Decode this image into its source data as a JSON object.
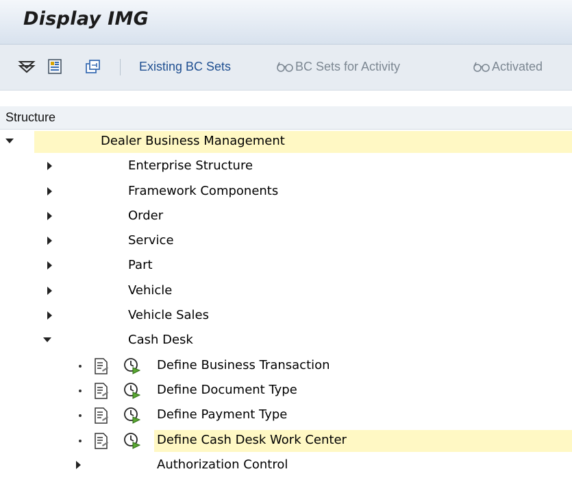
{
  "window": {
    "title": "Display IMG"
  },
  "toolbar": {
    "buttons": [
      {
        "label": "Existing BC Sets"
      },
      {
        "label": "BC Sets for Activity"
      },
      {
        "label": "Activated"
      }
    ]
  },
  "structure": {
    "header": "Structure"
  },
  "tree": {
    "root": {
      "label": "Dealer Business Management",
      "expanded": true
    },
    "items": [
      {
        "label": "Enterprise Structure",
        "expanded": false
      },
      {
        "label": "Framework Components",
        "expanded": false
      },
      {
        "label": "Order",
        "expanded": false
      },
      {
        "label": "Service",
        "expanded": false
      },
      {
        "label": "Part",
        "expanded": false
      },
      {
        "label": "Vehicle",
        "expanded": false
      },
      {
        "label": "Vehicle Sales",
        "expanded": false
      },
      {
        "label": "Cash Desk",
        "expanded": true
      }
    ],
    "cash_desk_children": [
      {
        "label": "Define Business Transaction"
      },
      {
        "label": "Define Document Type"
      },
      {
        "label": "Define Payment Type"
      },
      {
        "label": "Define Cash Desk Work Center"
      }
    ],
    "last": {
      "label": "Authorization Control",
      "expanded": false
    }
  },
  "colors": {
    "highlight": "#fff8c4",
    "toolbar_bg": "#e7ecf2",
    "link_blue": "#1f4f91"
  }
}
